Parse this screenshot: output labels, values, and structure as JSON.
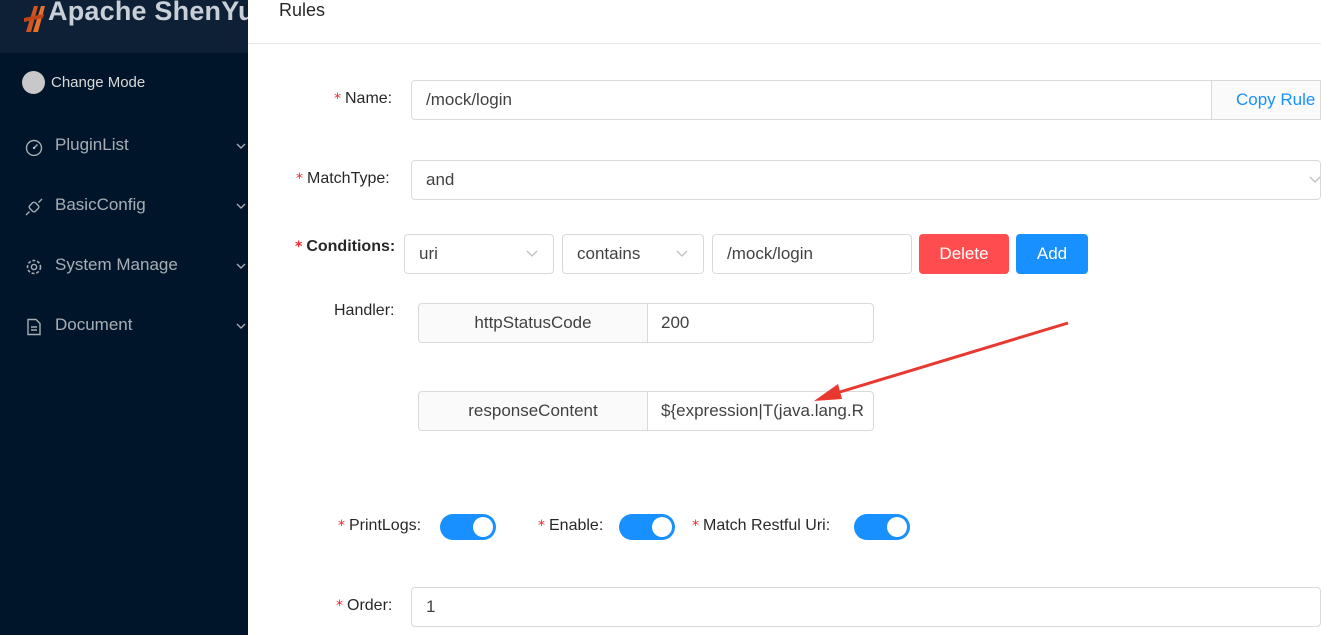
{
  "app": {
    "title": "Apache ShenYu",
    "mode_label": "Change Mode"
  },
  "sidebar": {
    "items": [
      {
        "label": "PluginList",
        "icon": "dashboard-icon"
      },
      {
        "label": "BasicConfig",
        "icon": "api-icon"
      },
      {
        "label": "System Manage",
        "icon": "setting-icon"
      },
      {
        "label": "Document",
        "icon": "file-icon"
      }
    ]
  },
  "page": {
    "title": "Rules"
  },
  "form": {
    "name": {
      "label": "Name:",
      "value": "/mock/login",
      "addon": "Copy Rule"
    },
    "match_type": {
      "label": "MatchType:",
      "value": "and"
    },
    "conditions": {
      "label": "Conditions:",
      "param_type": "uri",
      "operator": "contains",
      "value": "/mock/login",
      "delete_label": "Delete",
      "add_label": "Add"
    },
    "handler": {
      "label": "Handler:",
      "fields": [
        {
          "key": "httpStatusCode",
          "value": "200"
        },
        {
          "key": "responseContent",
          "value": "${expression|T(java.lang.R"
        }
      ]
    },
    "print_logs": {
      "label": "PrintLogs:",
      "checked": true
    },
    "enable": {
      "label": "Enable:",
      "checked": true
    },
    "match_restful": {
      "label": "Match Restful Uri:",
      "checked": true
    },
    "order": {
      "label": "Order:",
      "value": "1"
    }
  },
  "colors": {
    "sidebar_bg": "#001529",
    "primary": "#1890ff",
    "danger": "#ff4d4f",
    "annotation": "#e8382f"
  }
}
